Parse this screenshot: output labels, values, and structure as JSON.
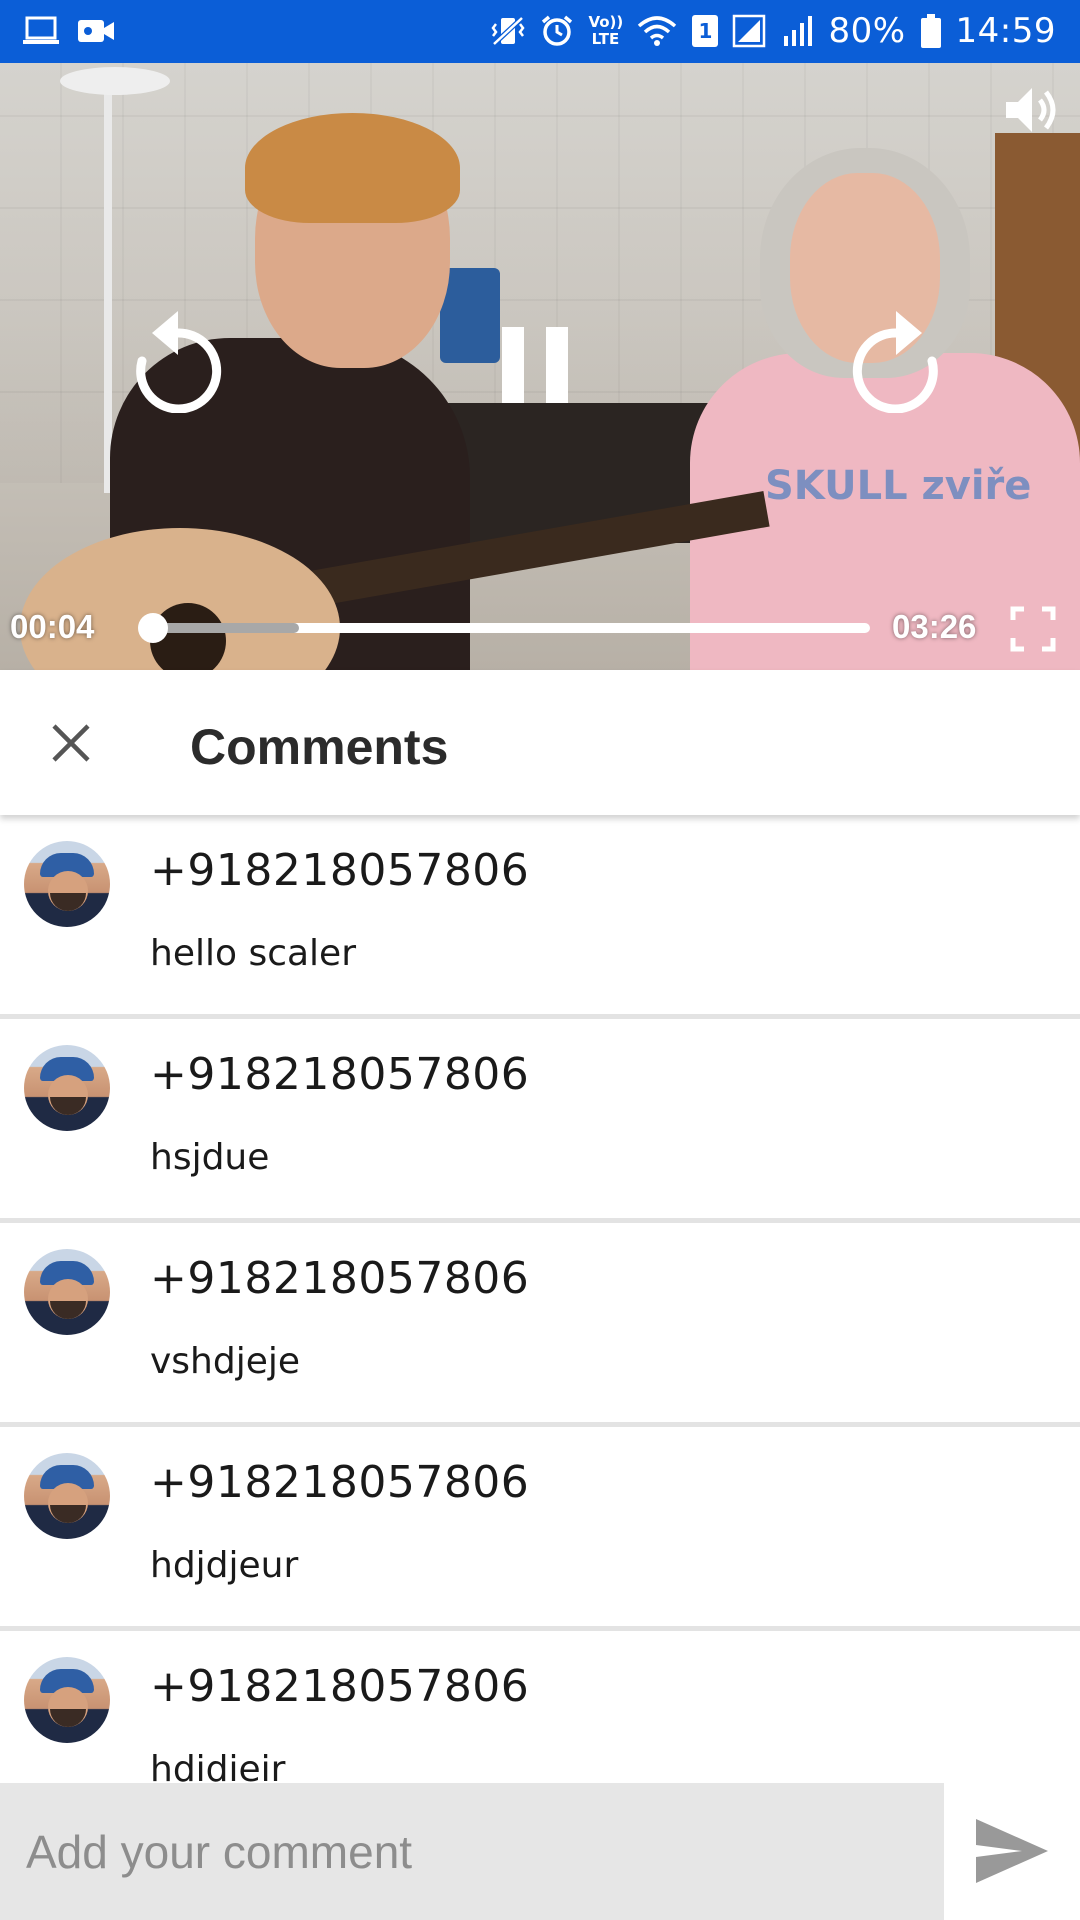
{
  "status_bar": {
    "battery": "80%",
    "time": "14:59",
    "left_icons": [
      "laptop-icon",
      "video-camera-icon"
    ],
    "right_icons": [
      "vibrate-icon",
      "alarm-icon",
      "volte-icon",
      "wifi-icon",
      "sim-1-icon",
      "signal-icon",
      "signal-icon",
      "battery-icon"
    ],
    "volte_text": "Vo)) LTE",
    "sim_text": "1"
  },
  "video": {
    "current_time": "00:04",
    "duration": "03:26",
    "progress_fraction": 0.02,
    "buffered_fraction": 0.22,
    "controls": [
      "rewind-icon",
      "pause-icon",
      "forward-icon",
      "volume-icon",
      "fullscreen-icon"
    ],
    "shirt_text": "SKULL zviře"
  },
  "comments_header": {
    "title": "Comments",
    "close_icon": "close-icon"
  },
  "comments": [
    {
      "author": "+918218057806",
      "text": "hello scaler"
    },
    {
      "author": "+918218057806",
      "text": "hsjdue"
    },
    {
      "author": "+918218057806",
      "text": "vshdjeje"
    },
    {
      "author": "+918218057806",
      "text": "hdjdjeur"
    },
    {
      "author": "+918218057806",
      "text": "hdidieir"
    }
  ],
  "input": {
    "placeholder": "Add your comment",
    "value": "",
    "send_icon": "send-icon"
  },
  "colors": {
    "status_bar": "#0b5ed7",
    "input_background": "#e6e6e6",
    "send_icon": "#999999",
    "divider": "#e3e3e3"
  }
}
